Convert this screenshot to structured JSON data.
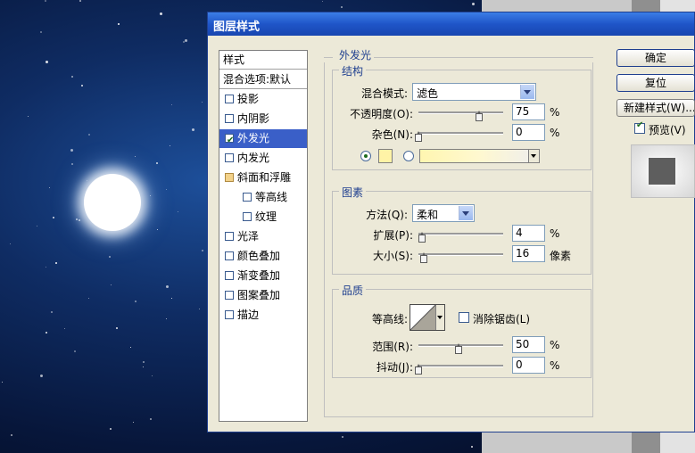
{
  "dialog": {
    "title": "图层样式"
  },
  "styles_list": {
    "header": "样式",
    "blend_default": "混合选项:默认",
    "items": [
      {
        "label": "投影",
        "checked": false,
        "selected": false
      },
      {
        "label": "内阴影",
        "checked": false,
        "selected": false
      },
      {
        "label": "外发光",
        "checked": true,
        "selected": true
      },
      {
        "label": "内发光",
        "checked": false,
        "selected": false
      },
      {
        "label": "斜面和浮雕",
        "checked": false,
        "selected": false
      },
      {
        "label": "等高线",
        "checked": false,
        "selected": false
      },
      {
        "label": "纹理",
        "checked": false,
        "selected": false
      },
      {
        "label": "光泽",
        "checked": false,
        "selected": false
      },
      {
        "label": "颜色叠加",
        "checked": false,
        "selected": false
      },
      {
        "label": "渐变叠加",
        "checked": false,
        "selected": false
      },
      {
        "label": "图案叠加",
        "checked": false,
        "selected": false
      },
      {
        "label": "描边",
        "checked": false,
        "selected": false
      }
    ]
  },
  "outer_glow": {
    "title": "外发光",
    "structure": {
      "title": "结构",
      "blend_mode_label": "混合模式:",
      "blend_mode_value": "滤色",
      "opacity_label": "不透明度(O):",
      "opacity_value": "75",
      "opacity_unit": "%",
      "opacity_level": 0.75,
      "noise_label": "杂色(N):",
      "noise_value": "0",
      "noise_unit": "%",
      "noise_level": 0,
      "color_swatch": "#fff3a6"
    },
    "elements": {
      "title": "图素",
      "technique_label": "方法(Q):",
      "technique_value": "柔和",
      "spread_label": "扩展(P):",
      "spread_value": "4",
      "spread_unit": "%",
      "spread_level": 0.04,
      "size_label": "大小(S):",
      "size_value": "16",
      "size_unit": "像素",
      "size_level": 0.065
    },
    "quality": {
      "title": "品质",
      "contour_label": "等高线:",
      "antialias_label": "消除锯齿(L)",
      "range_label": "范围(R):",
      "range_value": "50",
      "range_unit": "%",
      "range_level": 0.5,
      "jitter_label": "抖动(J):",
      "jitter_value": "0",
      "jitter_unit": "%",
      "jitter_level": 0
    }
  },
  "buttons": {
    "ok": "确定",
    "reset": "复位",
    "new_style": "新建样式(W)...",
    "preview": "预览(V)"
  }
}
